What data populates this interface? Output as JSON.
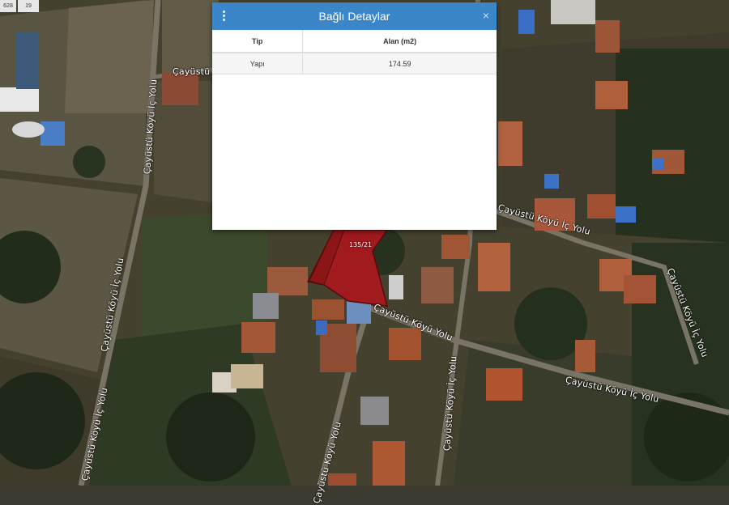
{
  "chips": [
    "628",
    "19"
  ],
  "roads": [
    "Çayüstü Köyü İç Yolu",
    "Çayüstü Köyü İç Yolu",
    "Çayüstü Köyü İç Yolu",
    "Çayüstü Köyü İç Yolu",
    "Çayüstü Köyü Yolu",
    "Çayüstü Köyü İç Yolu",
    "Çayüstü Köyü Yolu",
    "Çayüstü Köyü İç Yolu",
    "Çayüstü Köyü İç Yolu",
    "Çayüstü Köyü İç Yolu"
  ],
  "parcel": {
    "label": "135/21",
    "color": "#a01a1e"
  },
  "modal": {
    "title": "Bağlı Detaylar",
    "close": "×",
    "columns": [
      "Tip",
      "Alan (m2)"
    ],
    "rows": [
      {
        "tip": "Yapı",
        "alan": "174.59"
      }
    ],
    "header_color": "#3a86c8"
  }
}
